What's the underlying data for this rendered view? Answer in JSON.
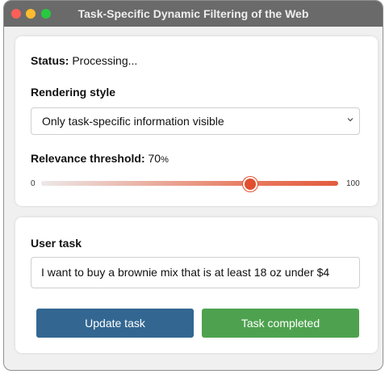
{
  "window": {
    "title": "Task-Specific Dynamic Filtering of the Web"
  },
  "status": {
    "label": "Status:",
    "value": "Processing..."
  },
  "rendering": {
    "label": "Rendering style",
    "selected": "Only task-specific information visible",
    "chevron_icon": "chevron-down-icon"
  },
  "threshold": {
    "label": "Relevance threshold:",
    "value_number": "70",
    "value_unit": "%",
    "value": 70,
    "min": "0",
    "max": "100"
  },
  "task": {
    "label": "User task",
    "value": "I want to buy a brownie mix that is at least 18 oz under $4"
  },
  "buttons": {
    "update": "Update task",
    "completed": "Task completed"
  },
  "colors": {
    "update_button": "#336791",
    "completed_button": "#4ea24f",
    "slider_accent": "#e14f2f",
    "titlebar": "#6a6a6a"
  }
}
